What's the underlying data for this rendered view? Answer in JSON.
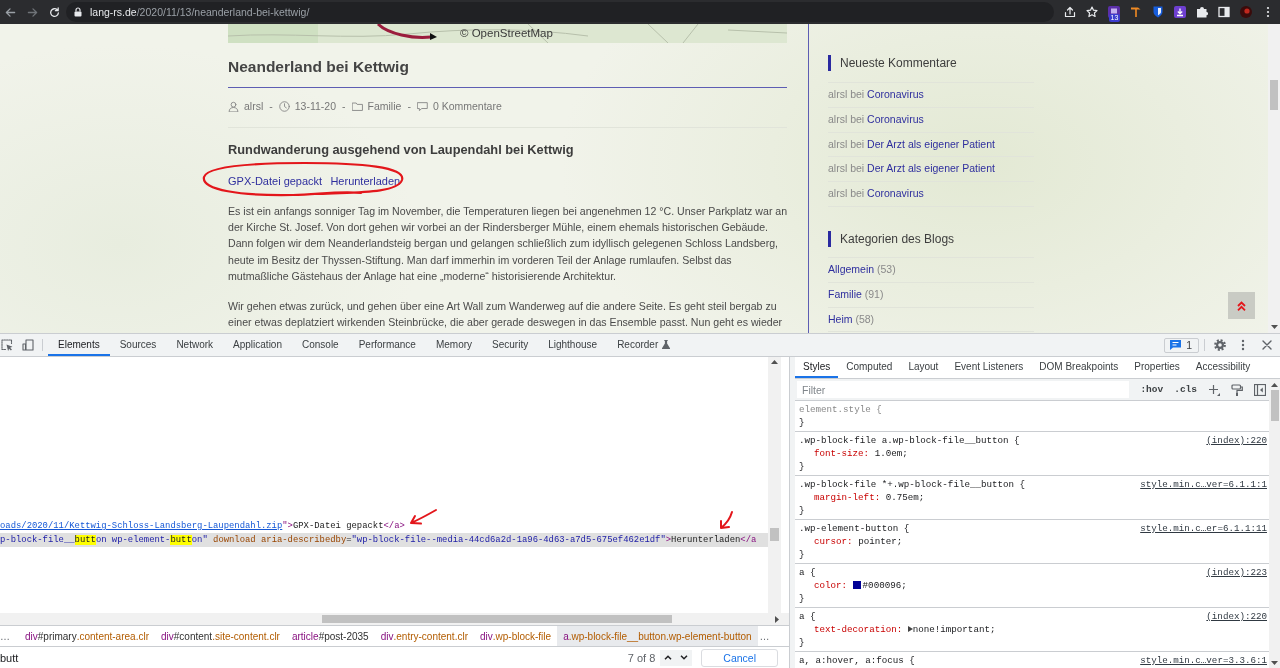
{
  "browser": {
    "address_host": "lang-rs.de",
    "address_path": "/2020/11/13/neanderland-bei-kettwig/",
    "extension_badge": "13"
  },
  "page": {
    "map_attribution": "© OpenStreetMap",
    "title": "Neanderland bei Kettwig",
    "meta": [
      {
        "kind": "author",
        "text": "alrsl"
      },
      {
        "kind": "date",
        "lead": "-",
        "text": "13-11-20"
      },
      {
        "kind": "category",
        "lead": "-",
        "text": "Familie"
      },
      {
        "kind": "comments",
        "lead": "-",
        "text": "0 Kommentare"
      }
    ],
    "subtitle": "Rundwanderung ausgehend von Laupendahl bei Kettwig",
    "file_block": {
      "name": "GPX-Datei gepackt",
      "button": "Herunterladen"
    },
    "paragraphs": [
      "Es ist ein anfangs sonniger Tag im November, die Temperaturen liegen bei angenehmen 12 °C. Unser Parkplatz war an der Kirche St. Josef. Von dort gehen wir vorbei an der Rindersberger Mühle, einem ehemals historischen Gebäude. Dann folgen wir dem Neanderlandsteig bergan und gelangen schließlich zum idyllisch gelegenen Schloss Landsberg, heute im Besitz der Thyssen-Stiftung. Man darf immerhin im vorderen Teil der Anlage rumlaufen. Selbst das mutmaßliche Gästehaus der Anlage hat eine „moderne“ historisierende Architektur.",
      "Wir gehen etwas zurück, und gehen über eine Art Wall zum Wanderweg auf die andere Seite. Es geht steil bergab zu einer etwas deplatziert wirkenden Steinbrücke, die aber gerade deswegen in das Ensemble passt. Nun geht es wieder"
    ]
  },
  "sidebar": {
    "widgets": [
      {
        "kind": "comments",
        "title": "Neueste Kommentare",
        "items": [
          {
            "author": "alrsl",
            "connector": "bei",
            "post": "Coronavirus"
          },
          {
            "author": "alrsl",
            "connector": "bei",
            "post": "Coronavirus"
          },
          {
            "author": "alrsl",
            "connector": "bei",
            "post": "Der Arzt als eigener Patient"
          },
          {
            "author": "alrsl",
            "connector": "bei",
            "post": "Der Arzt als eigener Patient"
          },
          {
            "author": "alrsl",
            "connector": "bei",
            "post": "Coronavirus"
          }
        ]
      },
      {
        "kind": "categories",
        "title": "Kategorien des Blogs",
        "items": [
          {
            "name": "Allgemein",
            "count": "(53)"
          },
          {
            "name": "Familie",
            "count": "(91)"
          },
          {
            "name": "Heim",
            "count": "(58)"
          }
        ]
      }
    ]
  },
  "devtools": {
    "tabs": [
      {
        "label": "Elements",
        "selected": true,
        "experimental": false
      },
      {
        "label": "Sources",
        "selected": false,
        "experimental": false
      },
      {
        "label": "Network",
        "selected": false,
        "experimental": false
      },
      {
        "label": "Application",
        "selected": false,
        "experimental": false
      },
      {
        "label": "Console",
        "selected": false,
        "experimental": false
      },
      {
        "label": "Performance",
        "selected": false,
        "experimental": false
      },
      {
        "label": "Memory",
        "selected": false,
        "experimental": false
      },
      {
        "label": "Security",
        "selected": false,
        "experimental": false
      },
      {
        "label": "Lighthouse",
        "selected": false,
        "experimental": false
      },
      {
        "label": "Recorder",
        "selected": false,
        "experimental": true
      }
    ],
    "issues_count": "1",
    "dom_lines": [
      {
        "selected": false,
        "segments": [
          {
            "kind": "link",
            "text": "oads/2020/11/Kettwig-Schloss-Landsberg-Laupendahl.zip"
          },
          {
            "kind": "tag",
            "text": "\">"
          },
          {
            "kind": "text",
            "text": "GPX-Datei gepackt"
          },
          {
            "kind": "tag",
            "text": "</a>"
          }
        ]
      },
      {
        "selected": true,
        "segments": [
          {
            "kind": "value",
            "text": "p-block-file__"
          },
          {
            "kind": "match",
            "text": "butt"
          },
          {
            "kind": "value",
            "text": "on wp-element-"
          },
          {
            "kind": "match",
            "text": "butt"
          },
          {
            "kind": "value",
            "text": "on\""
          },
          {
            "kind": "attr",
            "text": " download aria-describedby"
          },
          {
            "kind": "text",
            "text": "="
          },
          {
            "kind": "value",
            "text": "\"wp-block-file--media-44cd6a2d-1a96-4d63-a7d5-675ef462e1df\""
          },
          {
            "kind": "tag",
            "text": ">"
          },
          {
            "kind": "text",
            "text": "Herunterladen"
          },
          {
            "kind": "tag",
            "text": "</a"
          }
        ]
      }
    ],
    "breadcrumbs": {
      "overflow_left": "…",
      "crumbs": [
        {
          "tag": "div",
          "id": "#primary",
          "classes": ".content-area.clr",
          "selected": false
        },
        {
          "tag": "div",
          "id": "#content",
          "classes": ".site-content.clr",
          "selected": false
        },
        {
          "tag": "article",
          "id": "#post-2035",
          "selected": false
        },
        {
          "tag": "div",
          "classes": ".entry-content.clr",
          "selected": false
        },
        {
          "tag": "div",
          "classes": ".wp-block-file",
          "selected": false
        },
        {
          "tag": "a",
          "classes": ".wp-block-file__button.wp-element-button",
          "selected": true
        }
      ],
      "overflow_right": "…"
    },
    "search": {
      "value": "butt",
      "count": "7 of 8",
      "cancel": "Cancel"
    },
    "styles": {
      "tabs": [
        {
          "label": "Styles",
          "selected": true
        },
        {
          "label": "Computed",
          "selected": false
        },
        {
          "label": "Layout",
          "selected": false
        },
        {
          "label": "Event Listeners",
          "selected": false
        },
        {
          "label": "DOM Breakpoints",
          "selected": false
        },
        {
          "label": "Properties",
          "selected": false
        },
        {
          "label": "Accessibility",
          "selected": false
        }
      ],
      "filter_placeholder": "Filter",
      "hov": ":hov",
      "cls": ".cls",
      "rules": [
        {
          "kind": "inline",
          "selector": "element.style {",
          "close": "}"
        },
        {
          "kind": "rule",
          "selector": ".wp-block-file a.wp-block-file__button {",
          "source": "(index):220",
          "declarations": [
            {
              "property": "font-size:",
              "value": "1.0em;",
              "expandable": false
            }
          ],
          "close": "}"
        },
        {
          "kind": "rule",
          "selector": ".wp-block-file *+.wp-block-file__button {",
          "source": "style.min.c…ver=6.1.1:1",
          "declarations": [
            {
              "property": "margin-left:",
              "value": "0.75em;",
              "expandable": false
            }
          ],
          "close": "}"
        },
        {
          "kind": "rule",
          "selector": ".wp-element-button {",
          "source": "style.min.c…er=6.1.1:11",
          "declarations": [
            {
              "property": "cursor:",
              "value": "pointer;",
              "expandable": false
            }
          ],
          "close": "}"
        },
        {
          "kind": "rule",
          "selector": "a {",
          "source": "(index):223",
          "declarations": [
            {
              "property": "color:",
              "value": "#000096;",
              "color": "#000096",
              "expandable": false
            }
          ],
          "close": "}"
        },
        {
          "kind": "rule",
          "selector": "a {",
          "source": "(index):220",
          "declarations": [
            {
              "property": "text-decoration:",
              "value": "none!important;",
              "expandable": true
            }
          ],
          "close": "}"
        },
        {
          "kind": "rule",
          "selector": "a, a:hover, a:focus {",
          "source": "style.min.c…ver=3.3.6:1"
        }
      ]
    }
  }
}
